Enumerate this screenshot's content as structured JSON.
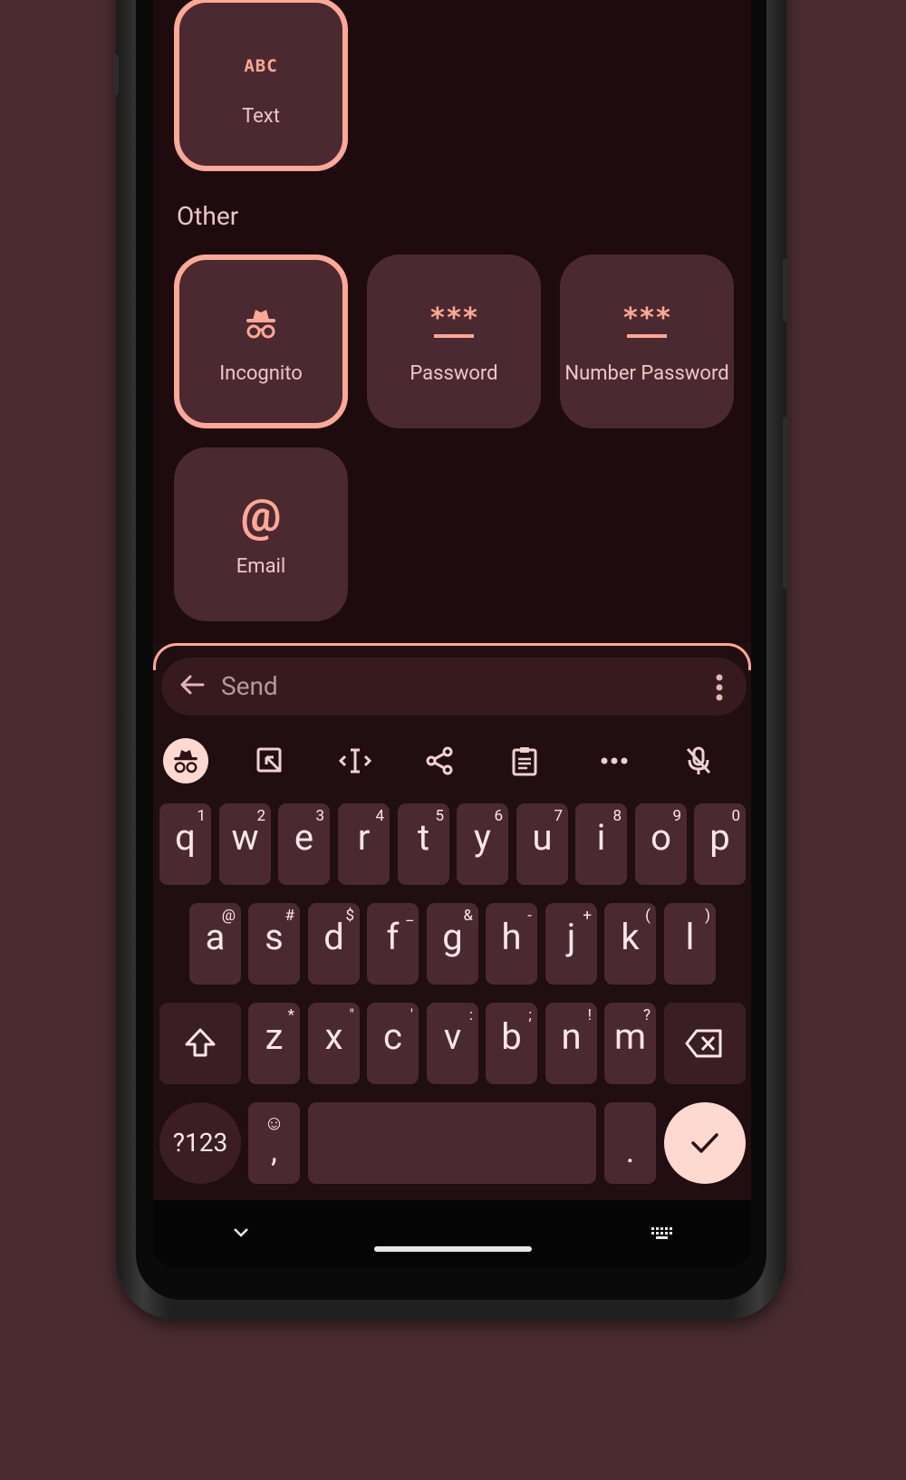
{
  "colors": {
    "background": "#4a2c30",
    "screen": "#1d0b0d",
    "tile": "#4a2a30",
    "accent": "#ffa896",
    "text": "#f0c3c3",
    "enter_key": "#ffd9cf"
  },
  "tiles": {
    "text": {
      "label": "Text",
      "icon_text": "ABC"
    },
    "section_other": "Other",
    "incognito": {
      "label": "Incognito"
    },
    "password": {
      "label": "Password",
      "icon_text": "***"
    },
    "number_password": {
      "label": "Number Password",
      "icon_text": "***"
    },
    "email": {
      "label": "Email",
      "icon_text": "@"
    }
  },
  "keyboard": {
    "input_placeholder": "Send",
    "toolbar_icons": [
      "incognito-icon",
      "handwriting-icon",
      "cursor-move-icon",
      "share-icon",
      "clipboard-icon",
      "more-icon",
      "mic-off-icon"
    ],
    "row1": [
      {
        "key": "q",
        "hint": "1"
      },
      {
        "key": "w",
        "hint": "2"
      },
      {
        "key": "e",
        "hint": "3"
      },
      {
        "key": "r",
        "hint": "4"
      },
      {
        "key": "t",
        "hint": "5"
      },
      {
        "key": "y",
        "hint": "6"
      },
      {
        "key": "u",
        "hint": "7"
      },
      {
        "key": "i",
        "hint": "8"
      },
      {
        "key": "o",
        "hint": "9"
      },
      {
        "key": "p",
        "hint": "0"
      }
    ],
    "row2": [
      {
        "key": "a",
        "hint": "@"
      },
      {
        "key": "s",
        "hint": "#"
      },
      {
        "key": "d",
        "hint": "$"
      },
      {
        "key": "f",
        "hint": "_"
      },
      {
        "key": "g",
        "hint": "&"
      },
      {
        "key": "h",
        "hint": "-"
      },
      {
        "key": "j",
        "hint": "+"
      },
      {
        "key": "k",
        "hint": "("
      },
      {
        "key": "l",
        "hint": ")"
      }
    ],
    "row3": [
      {
        "key": "z",
        "hint": "*"
      },
      {
        "key": "x",
        "hint": "\""
      },
      {
        "key": "c",
        "hint": "'"
      },
      {
        "key": "v",
        "hint": ":"
      },
      {
        "key": "b",
        "hint": ";"
      },
      {
        "key": "n",
        "hint": "!"
      },
      {
        "key": "m",
        "hint": "?"
      }
    ],
    "symbols_label": "?123",
    "comma_label": ",",
    "emoji_label": "☺",
    "period_label": "."
  }
}
